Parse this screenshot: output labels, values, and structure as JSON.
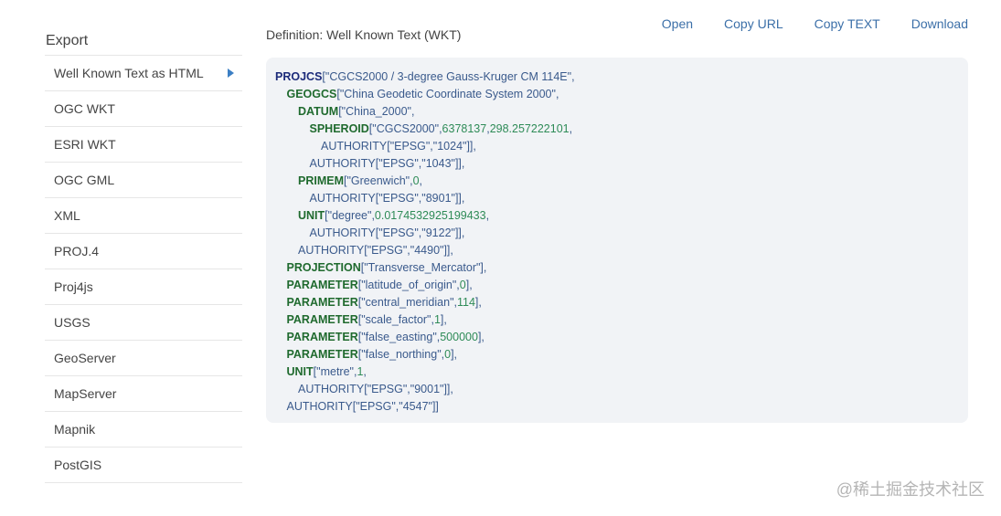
{
  "sidebar": {
    "title": "Export",
    "items": [
      {
        "label": "Well Known Text as HTML",
        "active": true
      },
      {
        "label": "OGC WKT"
      },
      {
        "label": "ESRI WKT"
      },
      {
        "label": "OGC GML"
      },
      {
        "label": "XML"
      },
      {
        "label": "PROJ.4"
      },
      {
        "label": "Proj4js"
      },
      {
        "label": "USGS"
      },
      {
        "label": "GeoServer"
      },
      {
        "label": "MapServer"
      },
      {
        "label": "Mapnik"
      },
      {
        "label": "PostGIS"
      }
    ]
  },
  "main": {
    "definition_label": "Definition: Well Known Text (WKT)",
    "actions": [
      "Open",
      "Copy URL",
      "Copy TEXT",
      "Download"
    ]
  },
  "wkt_lines": [
    {
      "indent": 0,
      "parts": [
        [
          "kw-root",
          "PROJCS"
        ],
        [
          "punc",
          "[\"CGCS2000 / 3-degree Gauss-Kruger CM 114E\","
        ]
      ]
    },
    {
      "indent": 1,
      "parts": [
        [
          "kw",
          "GEOGCS"
        ],
        [
          "punc",
          "[\"China Geodetic Coordinate System 2000\","
        ]
      ]
    },
    {
      "indent": 2,
      "parts": [
        [
          "kw",
          "DATUM"
        ],
        [
          "punc",
          "[\"China_2000\","
        ]
      ]
    },
    {
      "indent": 3,
      "parts": [
        [
          "kw",
          "SPHEROID"
        ],
        [
          "punc",
          "[\"CGCS2000\","
        ],
        [
          "num",
          "6378137"
        ],
        [
          "punc",
          ","
        ],
        [
          "num",
          "298.257222101"
        ],
        [
          "punc",
          ","
        ]
      ]
    },
    {
      "indent": 4,
      "parts": [
        [
          "punc",
          "AUTHORITY[\"EPSG\",\"1024\"]],"
        ]
      ]
    },
    {
      "indent": 3,
      "parts": [
        [
          "punc",
          "AUTHORITY[\"EPSG\",\"1043\"]],"
        ]
      ]
    },
    {
      "indent": 2,
      "parts": [
        [
          "kw",
          "PRIMEM"
        ],
        [
          "punc",
          "[\"Greenwich\","
        ],
        [
          "num",
          "0"
        ],
        [
          "punc",
          ","
        ]
      ]
    },
    {
      "indent": 3,
      "parts": [
        [
          "punc",
          "AUTHORITY[\"EPSG\",\"8901\"]],"
        ]
      ]
    },
    {
      "indent": 2,
      "parts": [
        [
          "kw",
          "UNIT"
        ],
        [
          "punc",
          "[\"degree\","
        ],
        [
          "num",
          "0.0174532925199433"
        ],
        [
          "punc",
          ","
        ]
      ]
    },
    {
      "indent": 3,
      "parts": [
        [
          "punc",
          "AUTHORITY[\"EPSG\",\"9122\"]],"
        ]
      ]
    },
    {
      "indent": 2,
      "parts": [
        [
          "punc",
          "AUTHORITY[\"EPSG\",\"4490\"]],"
        ]
      ]
    },
    {
      "indent": 1,
      "parts": [
        [
          "kw",
          "PROJECTION"
        ],
        [
          "punc",
          "[\"Transverse_Mercator\"],"
        ]
      ]
    },
    {
      "indent": 1,
      "parts": [
        [
          "kw",
          "PARAMETER"
        ],
        [
          "punc",
          "[\"latitude_of_origin\","
        ],
        [
          "num",
          "0"
        ],
        [
          "punc",
          "],"
        ]
      ]
    },
    {
      "indent": 1,
      "parts": [
        [
          "kw",
          "PARAMETER"
        ],
        [
          "punc",
          "[\"central_meridian\","
        ],
        [
          "num",
          "114"
        ],
        [
          "punc",
          "],"
        ]
      ]
    },
    {
      "indent": 1,
      "parts": [
        [
          "kw",
          "PARAMETER"
        ],
        [
          "punc",
          "[\"scale_factor\","
        ],
        [
          "num",
          "1"
        ],
        [
          "punc",
          "],"
        ]
      ]
    },
    {
      "indent": 1,
      "parts": [
        [
          "kw",
          "PARAMETER"
        ],
        [
          "punc",
          "[\"false_easting\","
        ],
        [
          "num",
          "500000"
        ],
        [
          "punc",
          "],"
        ]
      ]
    },
    {
      "indent": 1,
      "parts": [
        [
          "kw",
          "PARAMETER"
        ],
        [
          "punc",
          "[\"false_northing\","
        ],
        [
          "num",
          "0"
        ],
        [
          "punc",
          "],"
        ]
      ]
    },
    {
      "indent": 1,
      "parts": [
        [
          "kw",
          "UNIT"
        ],
        [
          "punc",
          "[\"metre\","
        ],
        [
          "num",
          "1"
        ],
        [
          "punc",
          ","
        ]
      ]
    },
    {
      "indent": 2,
      "parts": [
        [
          "punc",
          "AUTHORITY[\"EPSG\",\"9001\"]],"
        ]
      ]
    },
    {
      "indent": 1,
      "parts": [
        [
          "punc",
          "AUTHORITY[\"EPSG\",\"4547\"]]"
        ]
      ]
    }
  ],
  "watermark": "@稀土掘金技术社区",
  "colors": {
    "link": "#3b6fa8",
    "keyword": "#1f6a2e",
    "root_keyword": "#1c2b7a",
    "string": "#3a5a8c",
    "number": "#2e8b57",
    "code_bg": "#f1f3f6"
  }
}
